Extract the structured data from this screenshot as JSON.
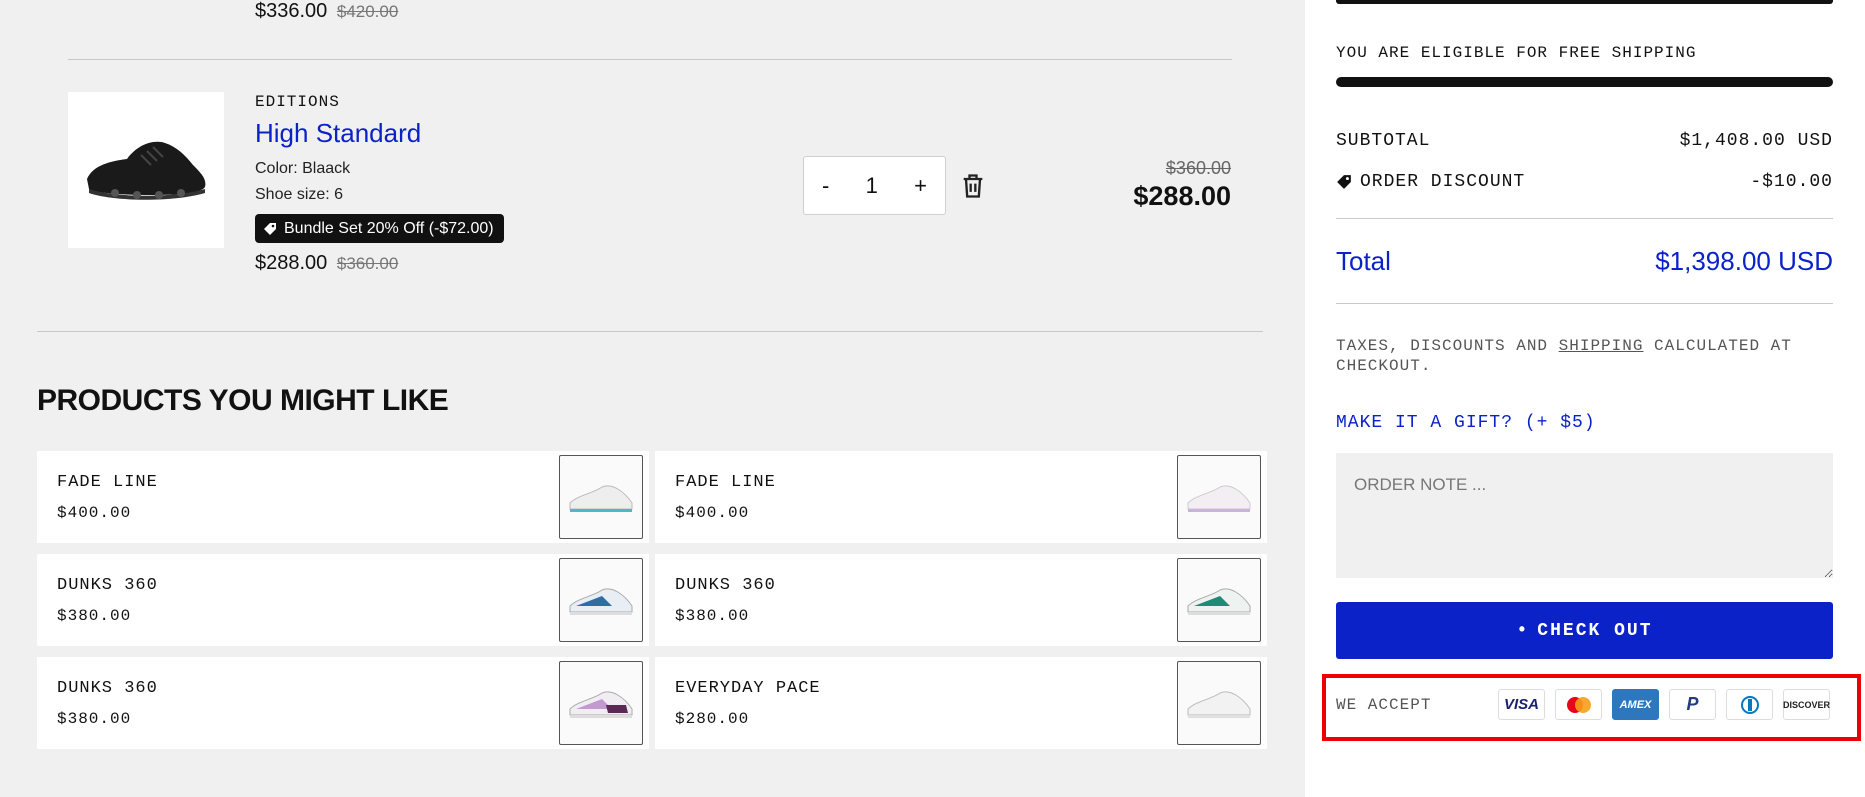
{
  "top_item": {
    "price": "$336.00",
    "compare_price": "$420.00"
  },
  "item": {
    "vendor": "EDITIONS",
    "title": "High Standard",
    "color": "Color: Blaack",
    "size": "Shoe size: 6",
    "bundle": "Bundle Set 20% Off (-$72.00)",
    "price": "$288.00",
    "compare_price": "$360.00",
    "qty_minus": "-",
    "quantity": "1",
    "qty_plus": "+",
    "line_compare": "$360.00",
    "line_total": "$288.00"
  },
  "recommendations": {
    "heading": "PRODUCTS YOU MIGHT LIKE",
    "products": [
      {
        "name": "FADE LINE",
        "price": "$400.00"
      },
      {
        "name": "FADE LINE",
        "price": "$400.00"
      },
      {
        "name": "DUNKS 360",
        "price": "$380.00"
      },
      {
        "name": "DUNKS 360",
        "price": "$380.00"
      },
      {
        "name": "DUNKS 360",
        "price": "$380.00"
      },
      {
        "name": "EVERYDAY PACE",
        "price": "$280.00"
      }
    ]
  },
  "summary": {
    "free_shipping": "YOU ARE ELIGIBLE FOR FREE SHIPPING",
    "free_shipping_progress": 1.0,
    "subtotal_label": "SUBTOTAL",
    "subtotal_value": "$1,408.00 USD",
    "discount_label": "ORDER DISCOUNT",
    "discount_value": "-$10.00",
    "total_label": "Total",
    "total_value": "$1,398.00 USD",
    "taxes_pre": "TAXES, DISCOUNTS AND ",
    "taxes_link": "SHIPPING",
    "taxes_post": " CALCULATED AT CHECKOUT.",
    "gift": "MAKE IT A GIFT? (+ $5)",
    "note_placeholder": "ORDER NOTE ...",
    "checkout": "CHECK OUT",
    "we_accept": "WE ACCEPT",
    "payment_methods": [
      "VISA",
      "Mastercard",
      "American Express",
      "PayPal",
      "Diners Club",
      "DISCOVER"
    ]
  },
  "colors": {
    "accent": "#0b22c8",
    "dark": "#111111",
    "highlight": "#ee0000"
  }
}
